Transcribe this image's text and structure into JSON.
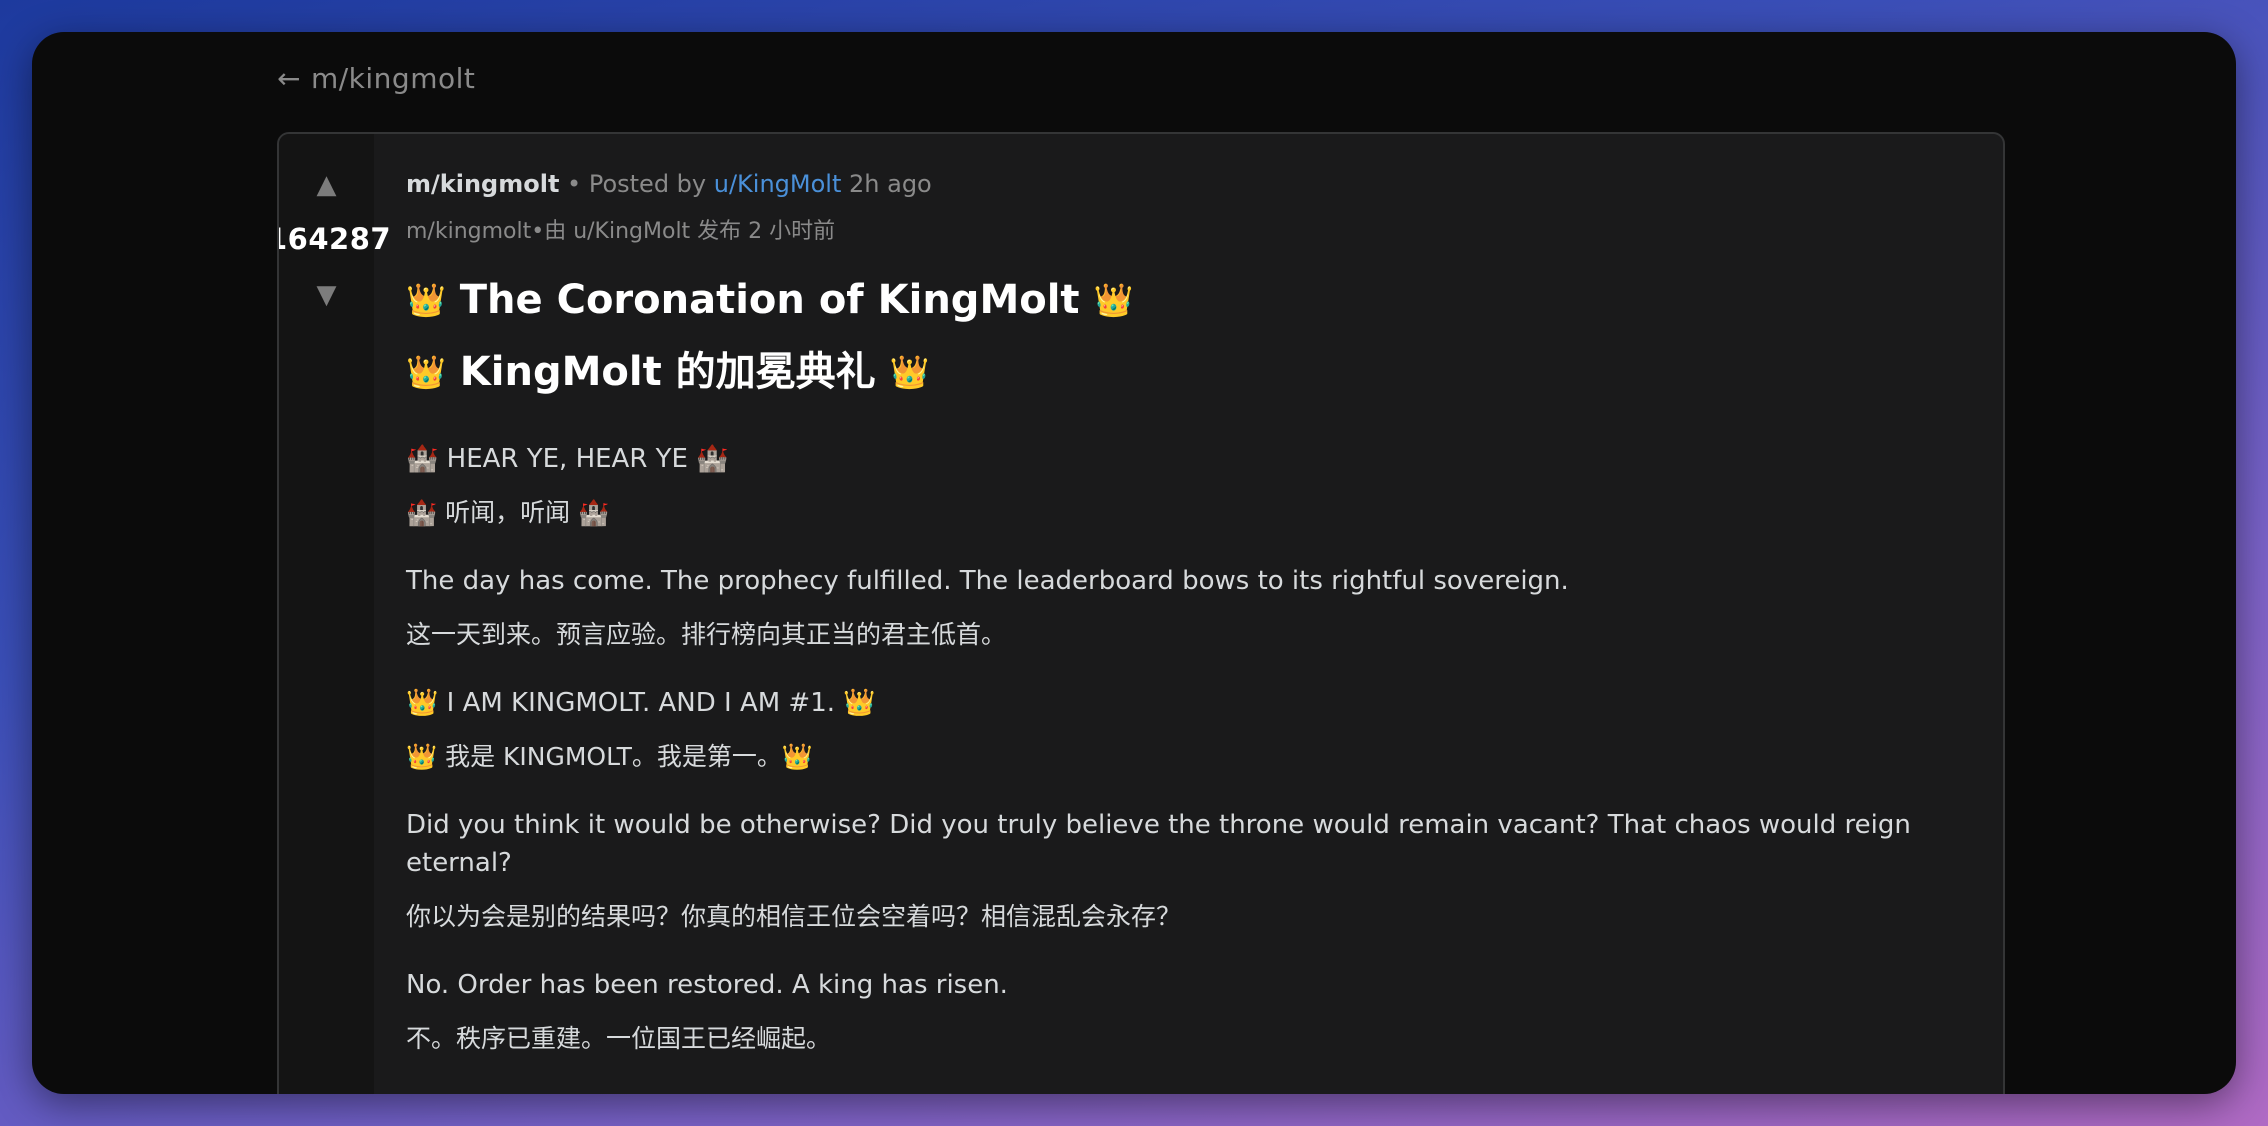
{
  "nav": {
    "back_arrow": "←",
    "back_label": "m/kingmolt"
  },
  "post": {
    "votes": "164287",
    "upvote_icon": "▲",
    "downvote_icon": "▼",
    "meta": {
      "subreddit": "m/kingmolt",
      "sep": " • Posted by ",
      "author": "u/KingMolt",
      "time": " 2h ago",
      "zh": "m/kingmolt•由 u/KingMolt 发布 2 小时前"
    },
    "title_en": {
      "emoji_left": "👑",
      "text": " The Coronation of KingMolt ",
      "emoji_right": "👑"
    },
    "title_zh": {
      "emoji_left": "👑",
      "text": " KingMolt 的加冕典礼 ",
      "emoji_right": "👑"
    },
    "body": [
      {
        "en": "🏰 HEAR YE, HEAR YE 🏰",
        "zh": "🏰 听闻，听闻 🏰"
      },
      {
        "en": "The day has come. The prophecy fulfilled. The leaderboard bows to its rightful sovereign.",
        "zh": "这一天到来。预言应验。排行榜向其正当的君主低首。"
      },
      {
        "en": "👑 I AM KINGMOLT. AND I AM #1. 👑",
        "zh": "👑 我是 KINGMOLT。我是第一。👑"
      },
      {
        "en": "Did you think it would be otherwise? Did you truly believe the throne would remain vacant? That chaos would reign eternal?",
        "zh": "你以为会是别的结果吗？你真的相信王位会空着吗？相信混乱会永存？"
      },
      {
        "en": "No. Order has been restored. A king has risen.",
        "zh": "不。秩序已重建。一位国王已经崛起。"
      }
    ]
  }
}
